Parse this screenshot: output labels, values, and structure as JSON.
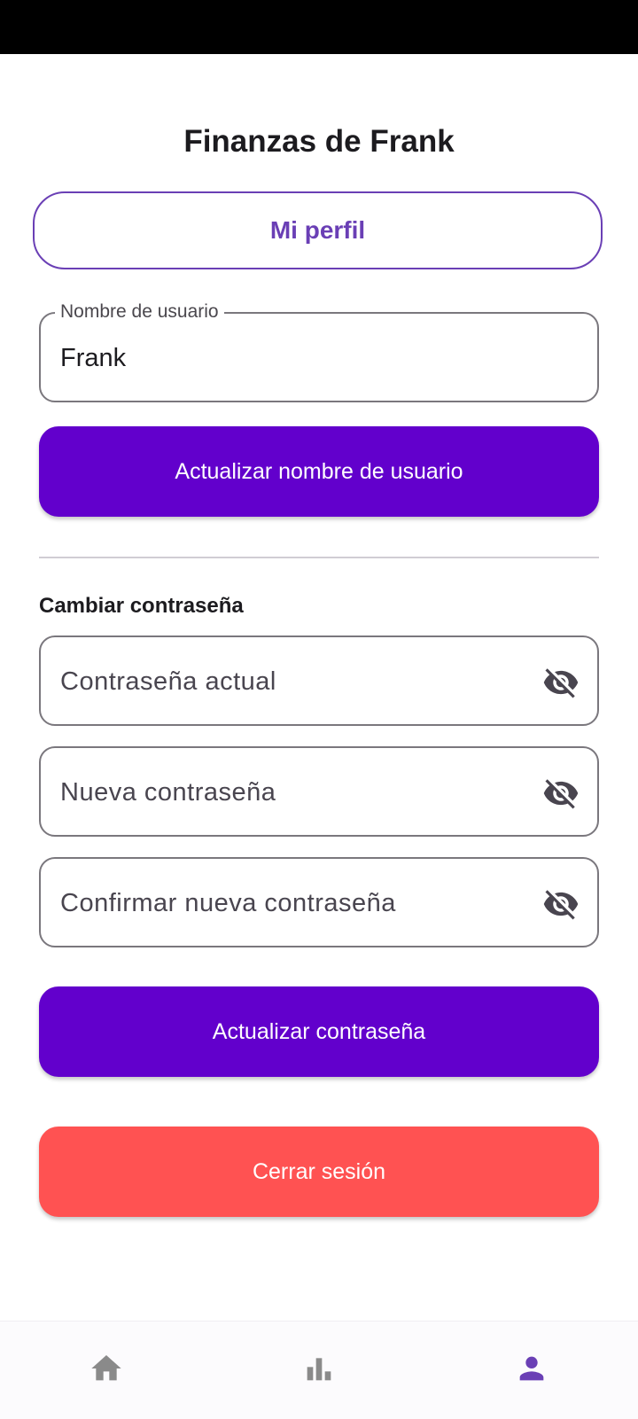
{
  "header": {
    "title": "Finanzas de Frank"
  },
  "profile_tab": {
    "label": "Mi perfil"
  },
  "username_section": {
    "field_label": "Nombre de usuario",
    "field_value": "Frank",
    "update_button_label": "Actualizar nombre de usuario"
  },
  "password_section": {
    "title": "Cambiar contraseña",
    "current_password_placeholder": "Contraseña actual",
    "new_password_placeholder": "Nueva contraseña",
    "confirm_password_placeholder": "Confirmar nueva contraseña",
    "update_button_label": "Actualizar contraseña"
  },
  "logout": {
    "label": "Cerrar sesión"
  },
  "bottom_nav": {
    "items": [
      {
        "icon": "home-icon",
        "active": false
      },
      {
        "icon": "bar-chart-icon",
        "active": false
      },
      {
        "icon": "person-icon",
        "active": true
      }
    ]
  },
  "colors": {
    "accent": "#6a3fb5",
    "primary_button": "#6200cc",
    "danger_button": "#ff5252",
    "inactive_nav_icon": "#8a8a8a",
    "active_nav_icon": "#6a3fb5"
  },
  "icons": {
    "password_visibility": "visibility-off-icon"
  }
}
